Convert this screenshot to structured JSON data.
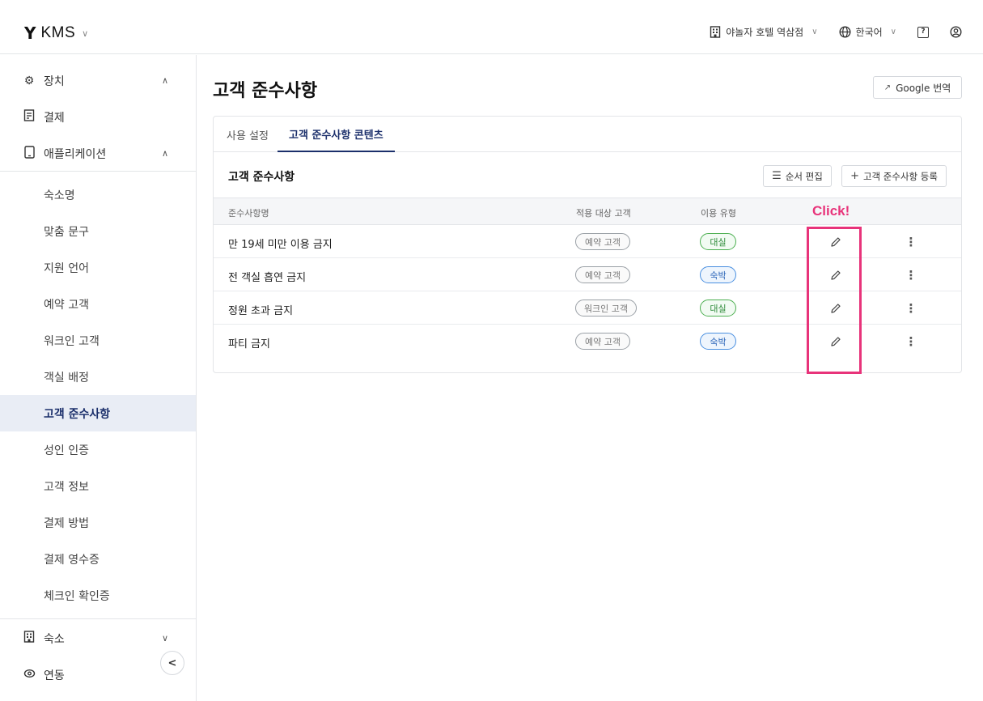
{
  "header": {
    "brand_logo": "Y",
    "brand_name": "KMS",
    "property": "야놀자 호텔 역삼점",
    "language": "한국어",
    "help_glyph": "?",
    "icons": [
      "building-icon",
      "globe-icon",
      "help-icon",
      "account-icon"
    ]
  },
  "sidebar": {
    "groups": [
      {
        "label": "장치",
        "icon": "gear-icon",
        "expanded": true
      },
      {
        "label": "결제",
        "icon": "receipt-icon"
      },
      {
        "label": "애플리케이션",
        "icon": "tablet-icon",
        "expanded": true
      }
    ],
    "app_items": [
      "숙소명",
      "맞춤 문구",
      "지원 언어",
      "예약 고객",
      "워크인 고객",
      "객실 배정",
      "고객 준수사항",
      "성인 인증",
      "고객 정보",
      "결제 방법",
      "결제 영수증",
      "체크인 확인증"
    ],
    "active_item": "고객 준수사항",
    "bottom_groups": [
      {
        "label": "숙소",
        "icon": "building-icon",
        "expanded": false
      },
      {
        "label": "연동",
        "icon": "link-icon"
      }
    ]
  },
  "main": {
    "title": "고객 준수사항",
    "translate_label": "Google 번역",
    "tabs": [
      {
        "label": "사용 설정",
        "active": false
      },
      {
        "label": "고객 준수사항 콘텐츠",
        "active": true
      }
    ],
    "section_title": "고객 준수사항",
    "reorder_label": "순서 편집",
    "add_label": "고객 준수사항 등록",
    "columns": [
      "준수사항명",
      "적용 대상 고객",
      "이용 유형"
    ],
    "annotation": "Click!",
    "rows": [
      {
        "name": "만 19세 미만 이용 금지",
        "target": "예약 고객",
        "type": "대실",
        "type_color": "green"
      },
      {
        "name": "전 객실 흡연 금지",
        "target": "예약 고객",
        "type": "숙박",
        "type_color": "blue"
      },
      {
        "name": "정원 초과 금지",
        "target": "워크인 고객",
        "type": "대실",
        "type_color": "green"
      },
      {
        "name": "파티 금지",
        "target": "예약 고객",
        "type": "숙박",
        "type_color": "blue"
      }
    ]
  },
  "colors": {
    "accent": "#1b2f6b",
    "highlight": "#e8337a",
    "active_bg": "#e9edf5",
    "pill_green": "#4caf50",
    "pill_blue": "#4a8fe0",
    "pill_gray": "#9aa0a6"
  }
}
